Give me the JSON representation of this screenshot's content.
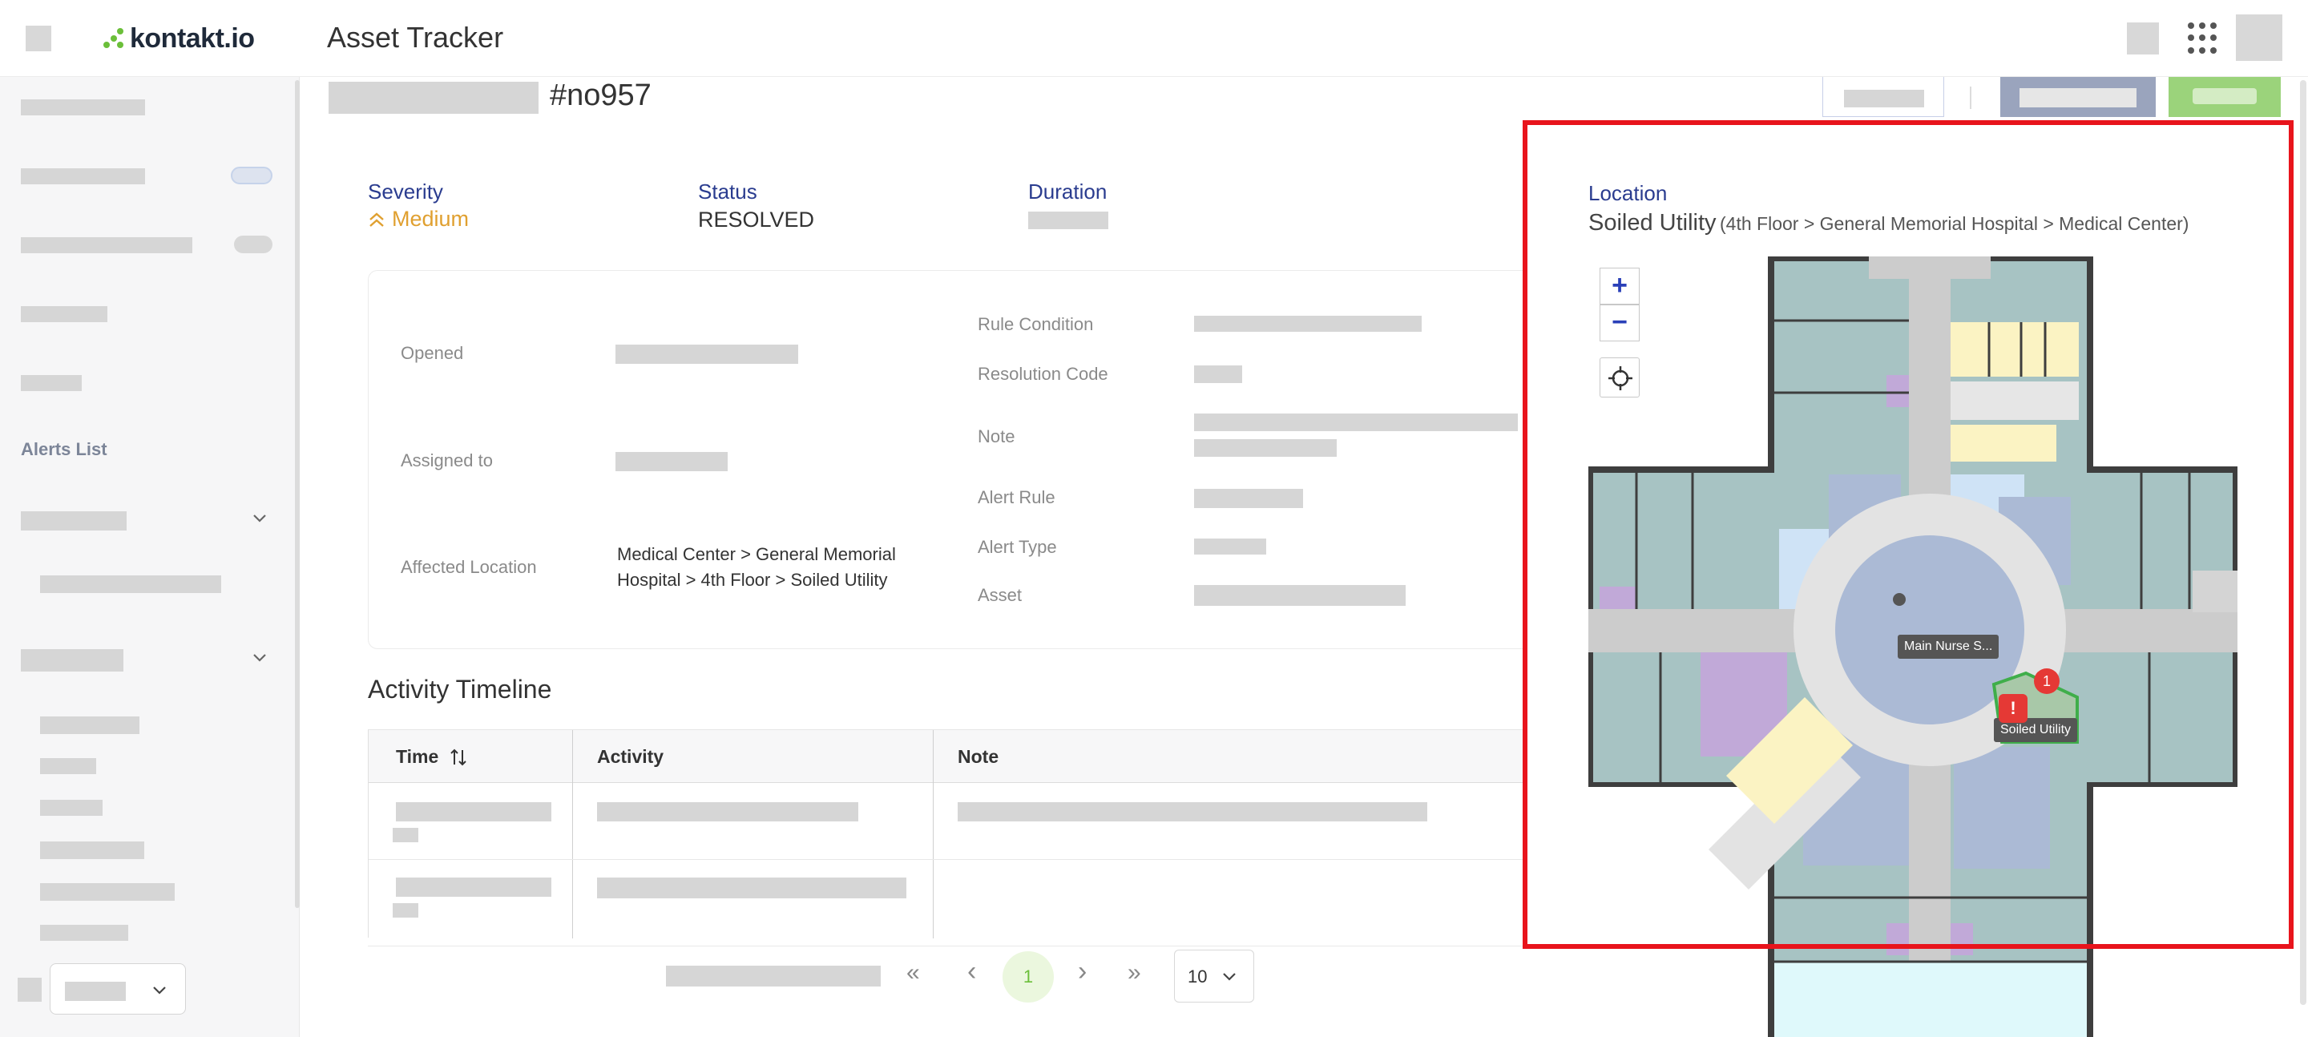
{
  "header": {
    "logo_text": "kontakt.io",
    "app_title": "Asset Tracker",
    "icons": [
      "menu-icon",
      "apps-grid-icon",
      "avatar"
    ]
  },
  "sidebar": {
    "active_item": "Alerts List",
    "per_page": ""
  },
  "alert": {
    "id": "#no957",
    "severity_label": "Severity",
    "severity_value": "Medium",
    "status_label": "Status",
    "status_value": "RESOLVED",
    "duration_label": "Duration"
  },
  "details": {
    "opened_label": "Opened",
    "assigned_label": "Assigned to",
    "affected_label": "Affected Location",
    "affected_value_line1": "Medical Center > General Memorial",
    "affected_value_line2": "Hospital > 4th Floor > Soiled Utility",
    "rule_condition_label": "Rule Condition",
    "resolution_code_label": "Resolution Code",
    "note_label": "Note",
    "alert_rule_label": "Alert Rule",
    "alert_type_label": "Alert Type",
    "asset_label": "Asset"
  },
  "timeline": {
    "title": "Activity Timeline",
    "columns": [
      "Time",
      "Activity",
      "Note"
    ],
    "sort_icon": "sort-arrows-icon"
  },
  "pagination": {
    "first": "«",
    "prev": "‹",
    "current_page": "1",
    "next": "›",
    "last": "»",
    "page_size": "10"
  },
  "location": {
    "label": "Location",
    "room": "Soiled Utility",
    "path": "(4th Floor > General Memorial Hospital > Medical Center)",
    "zoom_in": "+",
    "zoom_out": "−",
    "map_label_nurse": "Main Nurse S...",
    "map_label_room": "Soiled Utility",
    "alert_count": "1"
  },
  "colors": {
    "accent_blue": "#2a3c8f",
    "severity_orange": "#e0a030",
    "brand_green": "#6bbf3a",
    "highlight_red": "#e8141c",
    "alert_red": "#e53935"
  }
}
